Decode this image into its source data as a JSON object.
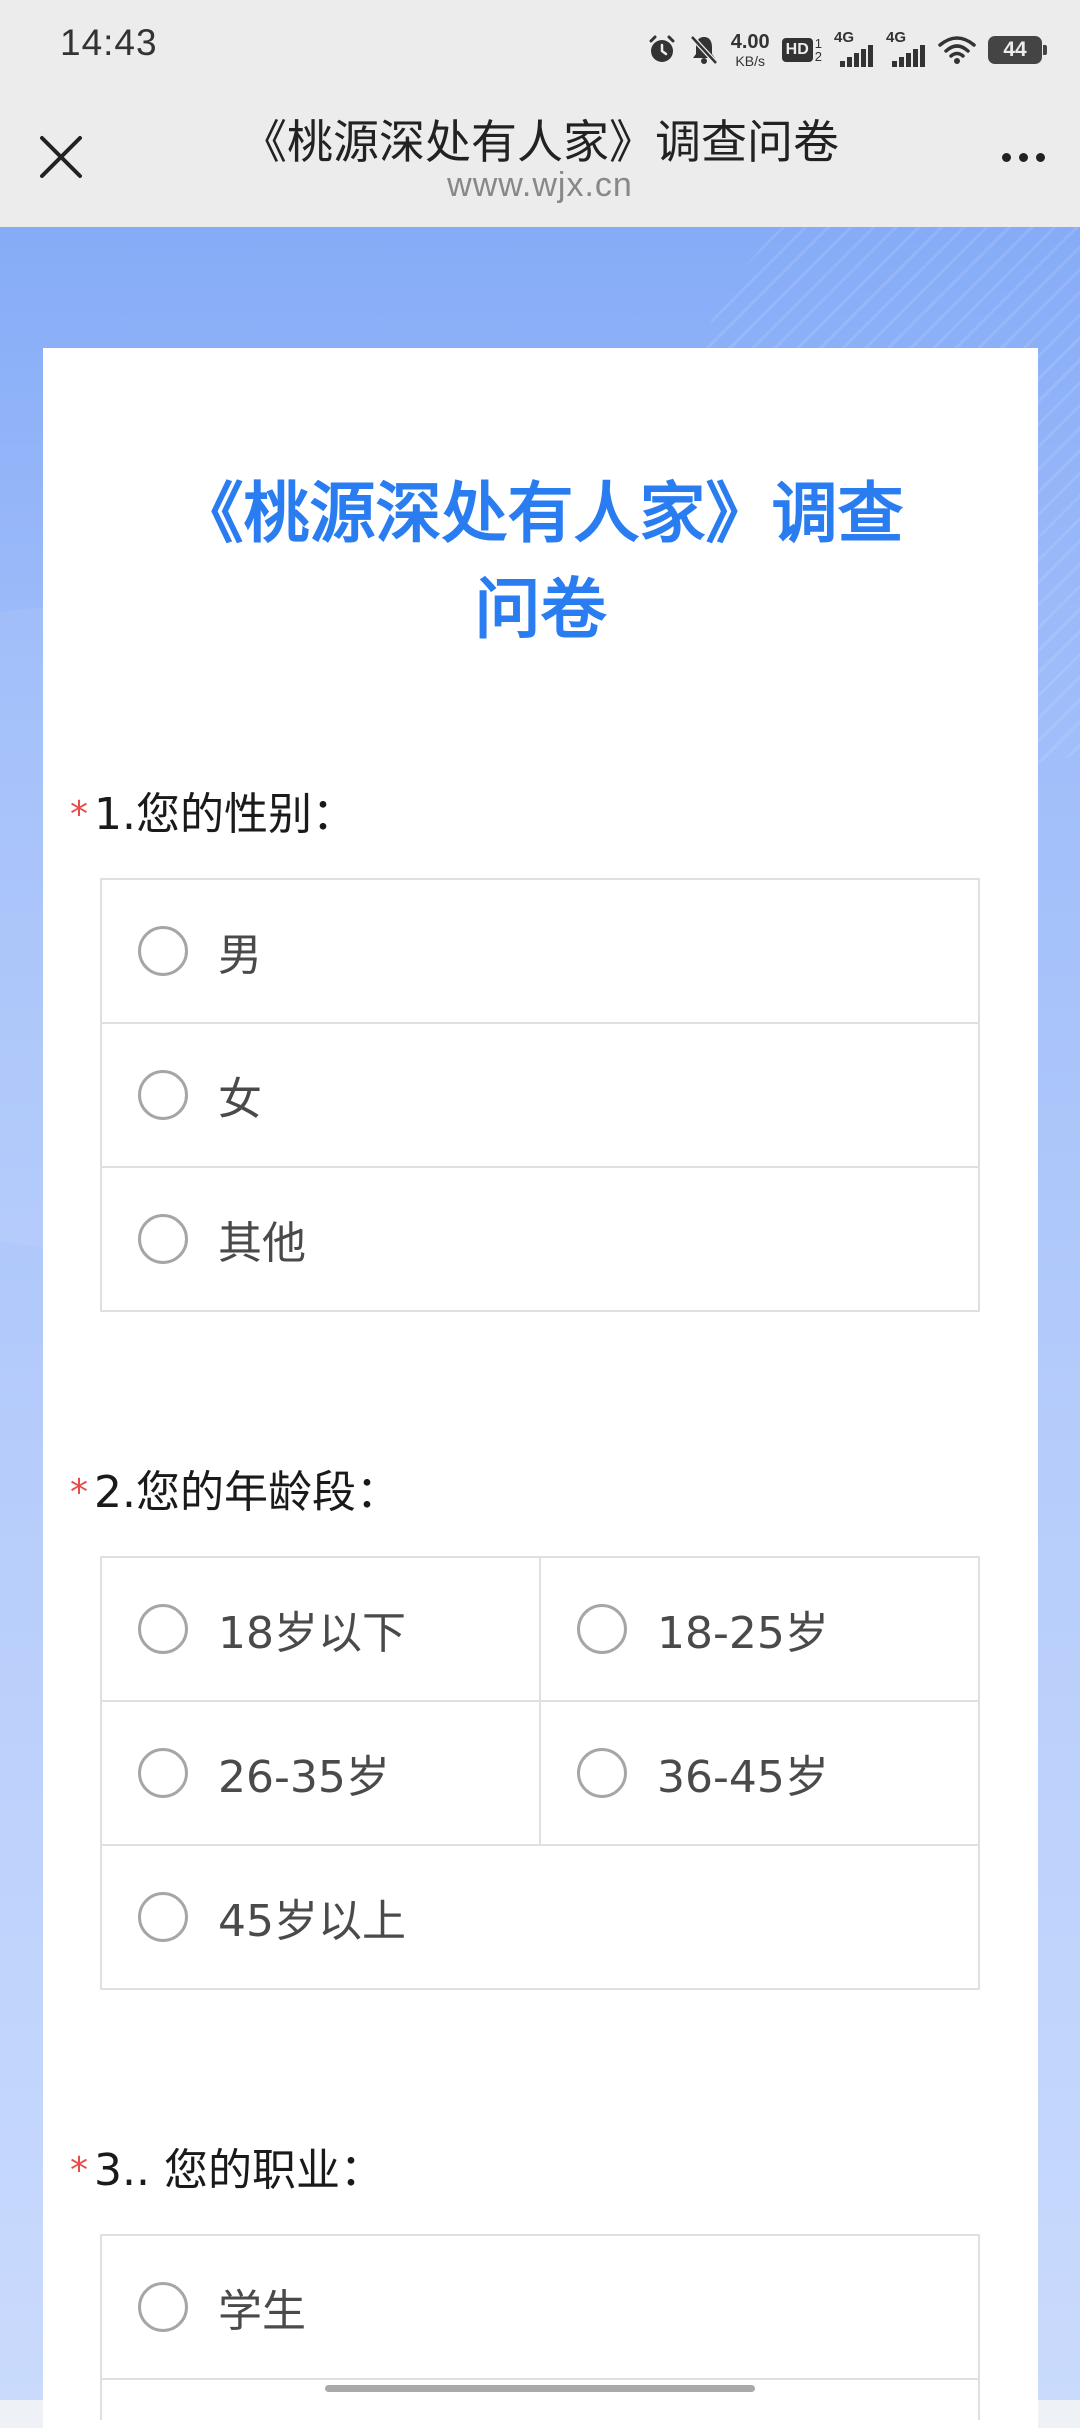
{
  "status_bar": {
    "time": "14:43",
    "net_speed_value": "4.00",
    "net_speed_unit": "KB/s",
    "hd_label": "HD",
    "sim_slot_1": "1",
    "sim_slot_2": "2",
    "network_1": "4G",
    "network_2": "4G",
    "battery_level": "44"
  },
  "header": {
    "title": "《桃源深处有人家》调查问卷",
    "url": "www.wjx.cn"
  },
  "survey": {
    "title": "《桃源深处有人家》调查问卷",
    "required_mark": "*",
    "questions": [
      {
        "title": "1.您的性别：",
        "options": [
          "男",
          "女",
          "其他"
        ]
      },
      {
        "title": "2.您的年龄段：",
        "options": [
          "18岁以下",
          "18-25岁",
          "26-35岁",
          "36-45岁",
          "45岁以上"
        ]
      },
      {
        "title": "3.. 您的职业：",
        "options": [
          "学生"
        ]
      }
    ]
  },
  "colors": {
    "accent": "#2a7df0",
    "required": "#e84b4b",
    "background_top": "#86acf7",
    "background_bottom": "#c9dafc"
  }
}
